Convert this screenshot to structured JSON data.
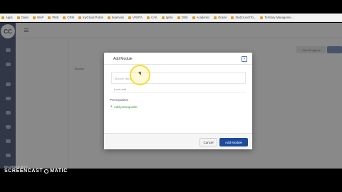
{
  "bookmarks": [
    "Apps",
    "Oasis",
    "MAP",
    "PMS",
    "CRM",
    "myCloud Portal",
    "Seamoss",
    "VFMTA",
    "CAS",
    "Ignite",
    "DNS",
    "Academic",
    "Oracle",
    "StatCrunchTo...",
    "Territory Manageme..."
  ],
  "app": {
    "logo_text": "CC",
    "view_progress_label": "View Progress",
    "section_title": "Module"
  },
  "modal": {
    "title": "Add Module",
    "close_glyph": "×",
    "name_placeholder": "Module Name",
    "lock_until_label": "Lock until",
    "prerequisites_label": "Prerequisites",
    "add_prerequisite_label": "Add prerequisite",
    "cancel_label": "Cancel",
    "submit_label": "Add Module"
  },
  "watermark": {
    "recorded_with": "RECORDED WITH",
    "brand_left": "SCREENCAST",
    "brand_right": "MATIC"
  },
  "colors": {
    "primary_button": "#1d4b9c",
    "sidebar": "#3d4a6b",
    "add_link": "#3a8d3a",
    "cursor_highlight": "#f1df3a"
  },
  "icons": {
    "close": "close-icon",
    "add": "plus-icon",
    "menu": "hamburger-icon"
  }
}
